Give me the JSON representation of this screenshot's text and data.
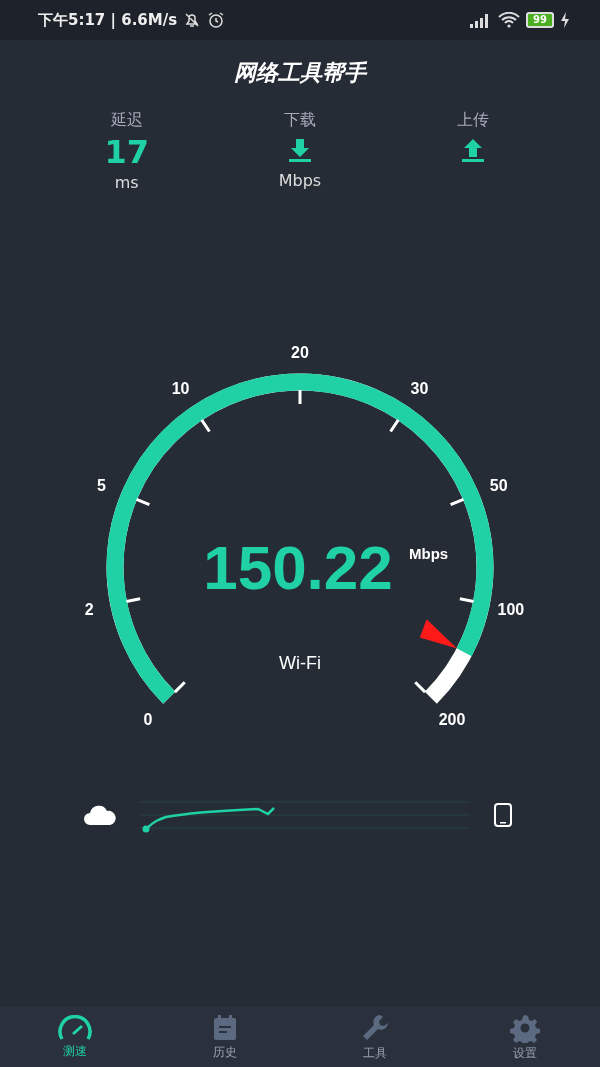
{
  "status_bar": {
    "time": "下午5:17 | 6.6M/s",
    "battery": "99"
  },
  "title": "网络工具帮手",
  "stats": [
    {
      "kind": "value",
      "label": "延迟",
      "value": "17",
      "unit": "ms"
    },
    {
      "kind": "download",
      "label": "下载",
      "unit": "Mbps"
    },
    {
      "kind": "upload",
      "label": "上传"
    }
  ],
  "gauge": {
    "scale_labels": [
      "0",
      "2",
      "5",
      "10",
      "20",
      "30",
      "50",
      "100",
      "200"
    ],
    "speed": "150.22",
    "unit": "Mbps",
    "network": "Wi-Fi"
  },
  "nav": [
    {
      "kind": "speed",
      "label": "测速",
      "selected": true
    },
    {
      "kind": "history",
      "label": "历史",
      "selected": false
    },
    {
      "kind": "tools",
      "label": "工具",
      "selected": false
    },
    {
      "kind": "settings",
      "label": "设置",
      "selected": false
    }
  ]
}
